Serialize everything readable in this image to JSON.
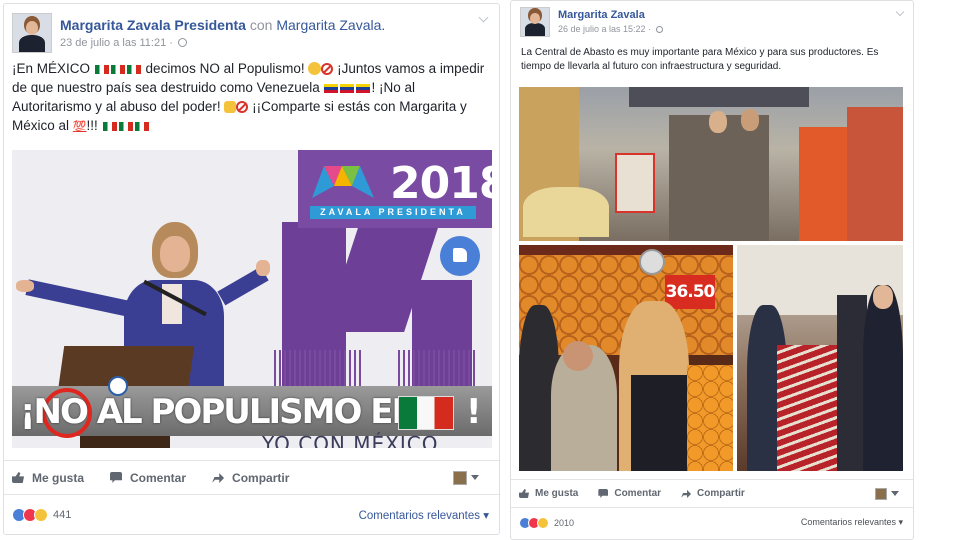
{
  "post1": {
    "author": "Margarita Zavala Presidenta",
    "with_text": "con",
    "with_name": "Margarita Zavala.",
    "date": "23 de julio a las 11:21 ·",
    "text_1": "¡En MÉXICO",
    "text_2": "decimos NO al Populismo!",
    "text_3": "¡Juntos vamos a impedir de que nuestro país sea destruido como Venezuela",
    "text_4": "! ¡No al Autoritarismo y al abuso del poder!",
    "text_5": "¡¡Comparte si estás con Margarita y México al",
    "text_6": "!!!",
    "hundred": "💯",
    "image": {
      "year": "2018",
      "brand_bar": "ZAVALA  PRESIDENTA",
      "banner": "¡NO AL POPULISMO EN",
      "banner_end": "!",
      "bottom_text": "YO CON MÉXICO"
    },
    "actions": {
      "like": "Me gusta",
      "comment": "Comentar",
      "share": "Compartir"
    },
    "reaction_count": "441",
    "relevant": "Comentarios relevantes ▾"
  },
  "post2": {
    "author": "Margarita Zavala",
    "date": "26 de julio a las 15:22 ·",
    "text": "La Central de Abasto es muy importante para México y para sus productores. Es tiempo de llevarla al futuro con infraestructura y seguridad.",
    "price": "36.50",
    "actions": {
      "like": "Me gusta",
      "comment": "Comentar",
      "share": "Compartir"
    },
    "reaction_count": "2010",
    "relevant": "Comentarios relevantes ▾"
  },
  "colors": {
    "link": "#365899",
    "brand_purple": "#6d3f96",
    "accent_blue": "#2f9bd6",
    "no_red": "#e0271f"
  }
}
